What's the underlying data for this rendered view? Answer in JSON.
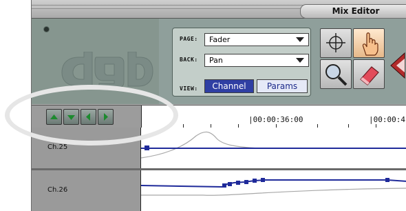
{
  "window": {
    "title": "Mix Editor"
  },
  "panel": {
    "page_label": "PAGE:",
    "page_value": "Fader",
    "back_label": "BACK:",
    "back_value": "Pan",
    "view_label": "VIEW:",
    "view_channel": "Channel",
    "view_params": "Params"
  },
  "tools": [
    "crosshair-tool",
    "hand-tool",
    "zoom-tool",
    "eraser-tool"
  ],
  "nav": [
    "up-arrow-icon",
    "down-arrow-icon",
    "left-arrow-icon",
    "right-arrow-icon"
  ],
  "ruler": {
    "tc1": "|00:00:36:00",
    "tc2": "|00:00:4"
  },
  "tracks": [
    {
      "name": "Ch.25"
    },
    {
      "name": "Ch.26"
    }
  ],
  "colors": {
    "accent": "#1f2a9a",
    "panel": "#c3cec9",
    "toolbar": "#8f9f9b"
  }
}
